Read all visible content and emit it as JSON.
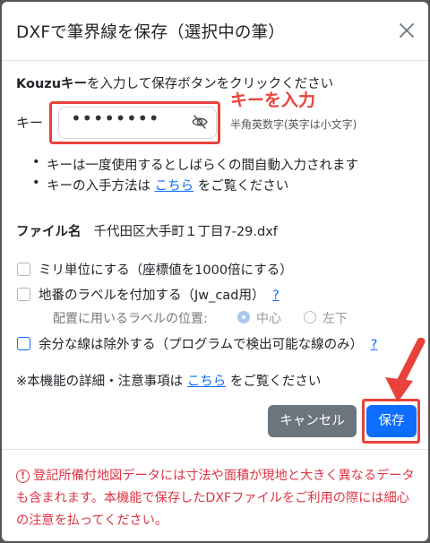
{
  "dialog": {
    "title": "DXFで筆界線を保存（選択中の筆）",
    "close_icon": "close-icon"
  },
  "key_section": {
    "instruction_bold": "Kouzuキー",
    "instruction_rest": "を入力して保存ボタンをクリックください",
    "label": "キー",
    "masked_value": "••••••••",
    "hint": "半角英数字(英字は小文字)",
    "annotation": "キーを入力",
    "eye_icon": "eye-slash-icon"
  },
  "bullets": {
    "item1": "キーは一度使用するとしばらくの間自動入力されます",
    "item2_prefix": "キーの入手方法は ",
    "item2_link": "こちら",
    "item2_suffix": " をご覧ください"
  },
  "file": {
    "label": "ファイル名",
    "value": "千代田区大手町１丁目7-29.dxf"
  },
  "options": {
    "mm_unit": "ミリ単位にする（座標値を1000倍にする）",
    "lot_label": "地番のラベルを付加する（Jw_cad用）",
    "lot_help": "?",
    "position_label": "配置に用いるラベルの位置:",
    "position_center": "中心",
    "position_bottom_left": "左下",
    "exclude_extra": "余分な線は除外する（プログラムで検出可能な線のみ）",
    "exclude_help": "?"
  },
  "note": {
    "prefix": "※本機能の詳細・注意事項は ",
    "link": "こちら",
    "suffix": " をご覧ください"
  },
  "buttons": {
    "cancel": "キャンセル",
    "save": "保存"
  },
  "warning": {
    "icon": "!",
    "text": "登記所備付地図データには寸法や面積が現地と大きく異なるデータも含まれます。本機能で保存したDXFファイルをご利用の際には細心の注意を払ってください。"
  },
  "colors": {
    "accent": "#0d6efd",
    "annotation_red": "#e8423b",
    "warning_red": "#dc3545",
    "cancel_gray": "#6c757d"
  }
}
